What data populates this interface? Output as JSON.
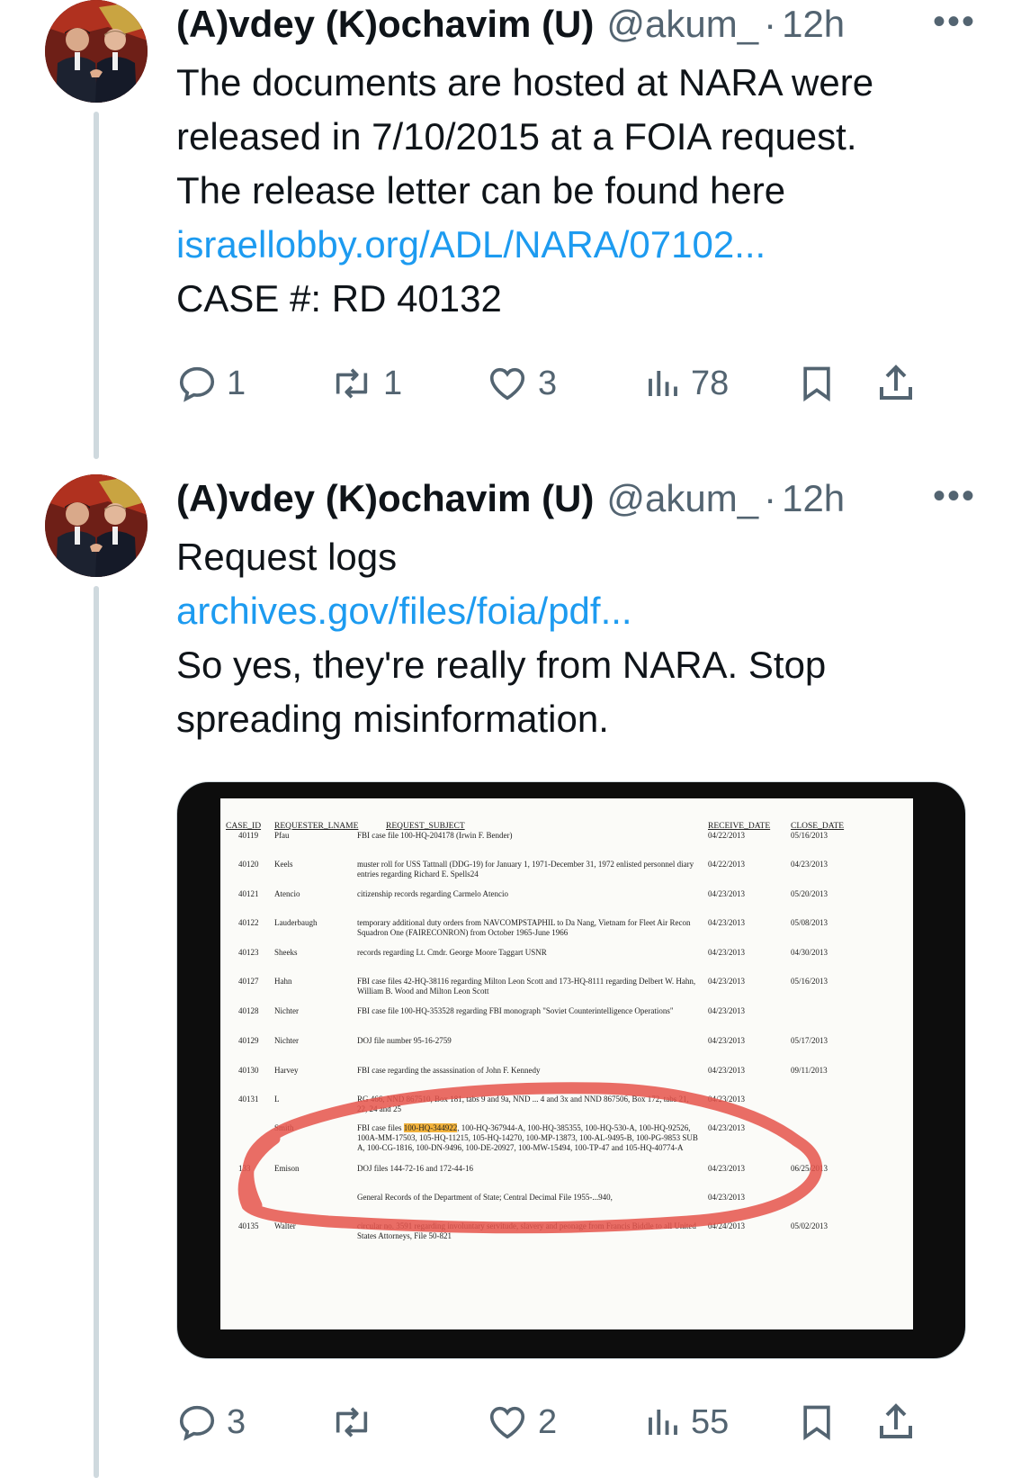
{
  "tweets": [
    {
      "display_name": "(A)vdey (K)ochavim (U)",
      "handle": "@akum_",
      "time": "12h",
      "more": "•••",
      "lines": [
        "The documents are hosted at NARA were",
        "released in 7/10/2015 at a FOIA request.",
        "The release letter can be found here"
      ],
      "link": "israellobby.org/ADL/NARA/07102...",
      "tail_lines": [
        "CASE #: RD 40132"
      ],
      "replies": "1",
      "reposts": "1",
      "likes": "3",
      "views": "78"
    },
    {
      "display_name": "(A)vdey (K)ochavim (U)",
      "handle": "@akum_",
      "time": "12h",
      "more": "•••",
      "lines": [
        "Request logs"
      ],
      "link": "archives.gov/files/foia/pdf...",
      "tail_lines": [
        "So yes, they're really from NARA. Stop",
        "spreading misinformation."
      ],
      "replies": "3",
      "reposts": "",
      "likes": "2",
      "views": "55"
    }
  ],
  "document": {
    "headers": {
      "case_id": "CASE_ID",
      "requester": "REQUESTER_LNAME",
      "subject": "REQUEST_SUBJECT",
      "receive": "RECEIVE_DATE",
      "close": "CLOSE_DATE"
    },
    "rows": [
      {
        "id": "40119",
        "name": "Pfau",
        "subject": "FBI case file 100-HQ-204178 (Irwin F. Bender)",
        "receive": "04/22/2013",
        "close": "05/16/2013"
      },
      {
        "id": "40120",
        "name": "Keels",
        "subject": "muster roll for USS Tattnall (DDG-19) for January 1, 1971-December 31, 1972 enlisted personnel diary entries regarding Richard E. Spells24",
        "receive": "04/22/2013",
        "close": "04/23/2013"
      },
      {
        "id": "40121",
        "name": "Atencio",
        "subject": "citizenship records regarding Carmelo Atencio",
        "receive": "04/23/2013",
        "close": "05/20/2013"
      },
      {
        "id": "40122",
        "name": "Lauderbaugh",
        "subject": "temporary additional duty orders from NAVCOMPSTAPHIL to Da Nang, Vietnam for Fleet Air Recon Squadron One (FAIRECONRON) from October 1965-June 1966",
        "receive": "04/23/2013",
        "close": "05/08/2013"
      },
      {
        "id": "40123",
        "name": "Sheeks",
        "subject": "records regarding Lt. Cmdr. George Moore Taggart USNR",
        "receive": "04/23/2013",
        "close": "04/30/2013"
      },
      {
        "id": "40127",
        "name": "Hahn",
        "subject": "FBI case files 42-HQ-38116 regarding Milton Leon Scott and 173-HQ-8111 regarding Delbert W. Hahn, William B. Wood and Milton Leon Scott",
        "receive": "04/23/2013",
        "close": "05/16/2013"
      },
      {
        "id": "40128",
        "name": "Nichter",
        "subject": "FBI case file 100-HQ-353528 regarding FBI monograph \"Soviet Counterintelligence Operations\"",
        "receive": "04/23/2013",
        "close": ""
      },
      {
        "id": "40129",
        "name": "Nichter",
        "subject": "DOJ file number 95-16-2759",
        "receive": "04/23/2013",
        "close": "05/17/2013"
      },
      {
        "id": "40130",
        "name": "Harvey",
        "subject": "FBI case regarding the assassination of John F. Kennedy",
        "receive": "04/23/2013",
        "close": "09/11/2013"
      },
      {
        "id": "40131",
        "name": "L",
        "subject": "RG 466, NND 867510, Box 181, tabs 9 and 9a, NND ... 4 and 3x and NND 867506, Box 172, tabs 21, 22, 24 and 25",
        "receive": "04/23/2013",
        "close": ""
      },
      {
        "id": "",
        "name": "Smith",
        "subject_hl": "100-HQ-344922",
        "subject_pre": "FBI case files ",
        "subject": ", 100-HQ-367944-A, 100-HQ-385355, 100-HQ-530-A, 100-HQ-92526, 100A-MM-17503, 105-HQ-11215, 105-HQ-14270, 100-MP-13873, 100-AL-9495-B, 100-PG-9853 SUB A, 100-CG-1816, 100-DN-9496, 100-DE-20927, 100-MW-15494, 100-TP-47 and 105-HQ-40774-A",
        "receive": "04/23/2013",
        "close": ""
      },
      {
        "id": "133",
        "name": "Emison",
        "subject": "DOJ files 144-72-16 and 172-44-16",
        "receive": "04/23/2013",
        "close": "06/25/2013"
      },
      {
        "id": "",
        "name": "",
        "subject": "General Records of the Department of State; Central Decimal File 1955-...940,",
        "receive": "04/23/2013",
        "close": ""
      },
      {
        "id": "40135",
        "name": "Walter",
        "subject": "circular no. 3591 regarding involuntary servitude, slavery and peonage from Francis Biddle to all United States Attorneys, File 50-821",
        "receive": "04/24/2013",
        "close": "05/02/2013"
      }
    ]
  },
  "colors": {
    "link": "#1d9bf0",
    "muted": "#536471",
    "annotation": "#e5534b",
    "highlight": "#f2b33d"
  },
  "icons": [
    "reply-icon",
    "repost-icon",
    "like-icon",
    "views-icon",
    "bookmark-icon",
    "share-icon"
  ]
}
